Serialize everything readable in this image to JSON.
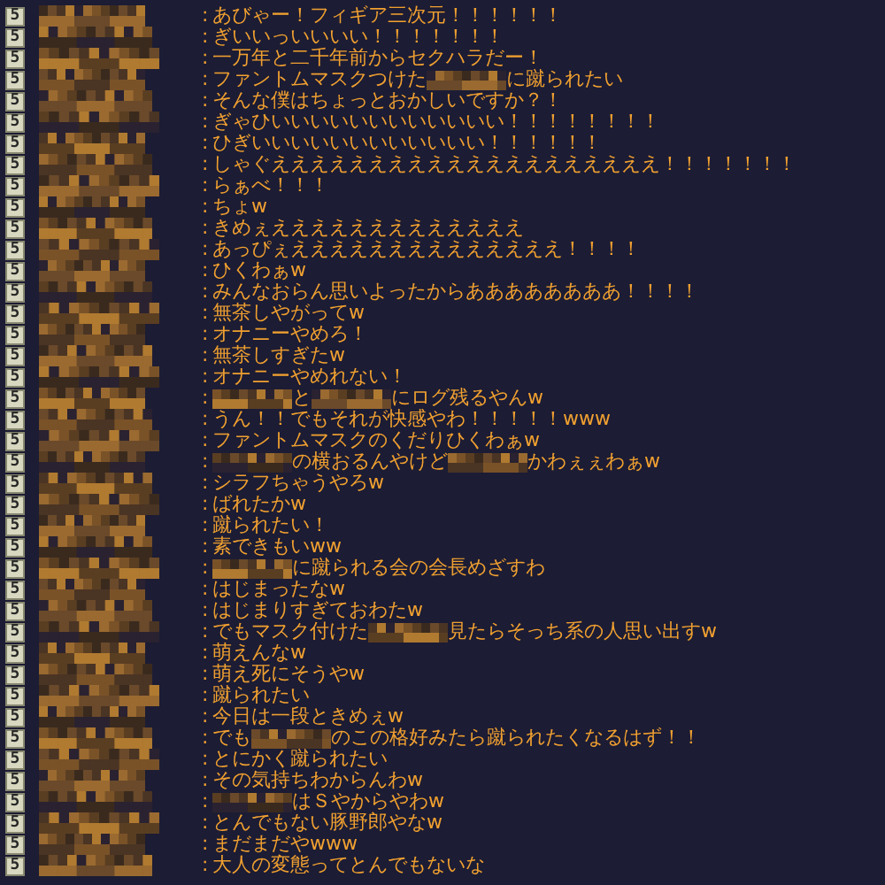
{
  "rows": [
    {
      "badge": "5",
      "sep": ":",
      "message": [
        {
          "kind": "text",
          "text": "あびゃー！フィギア三次元！！！！！！"
        }
      ]
    },
    {
      "badge": "5",
      "sep": ":",
      "message": [
        {
          "kind": "text",
          "text": "ぎいいっいいいい！！！！！！！"
        }
      ]
    },
    {
      "badge": "5",
      "sep": ":",
      "message": [
        {
          "kind": "text",
          "text": "一万年と二千年前からセクハラだー！"
        }
      ]
    },
    {
      "badge": "5",
      "sep": ":",
      "message": [
        {
          "kind": "text",
          "text": "ファントムマスクつけた"
        },
        {
          "kind": "mosaic"
        },
        {
          "kind": "text",
          "text": "に蹴られたい"
        }
      ]
    },
    {
      "badge": "5",
      "sep": ":",
      "message": [
        {
          "kind": "text",
          "text": "そんな僕はちょっとおかしいですか？！"
        }
      ]
    },
    {
      "badge": "5",
      "sep": ":",
      "message": [
        {
          "kind": "text",
          "text": "ぎゃひいいいいいいいいいいいい！！！！！！！！"
        }
      ]
    },
    {
      "badge": "5",
      "sep": ":",
      "message": [
        {
          "kind": "text",
          "text": "ひぎいいいいいいいいいいいい！！！！！！"
        }
      ]
    },
    {
      "badge": "5",
      "sep": ":",
      "message": [
        {
          "kind": "text",
          "text": "しゃぐええええええええええええええええええええ！！！！！！！"
        }
      ]
    },
    {
      "badge": "5",
      "sep": ":",
      "message": [
        {
          "kind": "text",
          "text": "らぁべ！！！"
        }
      ]
    },
    {
      "badge": "5",
      "sep": ":",
      "message": [
        {
          "kind": "text",
          "text": "ちょw"
        }
      ]
    },
    {
      "badge": "5",
      "sep": ":",
      "message": [
        {
          "kind": "text",
          "text": "きめぇえええええええええええええ"
        }
      ]
    },
    {
      "badge": "5",
      "sep": ":",
      "message": [
        {
          "kind": "text",
          "text": "あっぴぇええええええええええええええ！！！！"
        }
      ]
    },
    {
      "badge": "5",
      "sep": ":",
      "message": [
        {
          "kind": "text",
          "text": "ひくわぁw"
        }
      ]
    },
    {
      "badge": "5",
      "sep": ":",
      "message": [
        {
          "kind": "text",
          "text": "みんなおらん思いよったからああああああああ！！！！"
        }
      ]
    },
    {
      "badge": "5",
      "sep": ":",
      "message": [
        {
          "kind": "text",
          "text": "無茶しやがってw"
        }
      ]
    },
    {
      "badge": "5",
      "sep": ":",
      "message": [
        {
          "kind": "text",
          "text": "オナニーやめろ！"
        }
      ]
    },
    {
      "badge": "5",
      "sep": ":",
      "message": [
        {
          "kind": "text",
          "text": "無茶しすぎたw"
        }
      ]
    },
    {
      "badge": "5",
      "sep": ":",
      "message": [
        {
          "kind": "text",
          "text": "オナニーやめれない！"
        }
      ]
    },
    {
      "badge": "5",
      "sep": ":",
      "message": [
        {
          "kind": "mosaic"
        },
        {
          "kind": "text",
          "text": "と"
        },
        {
          "kind": "mosaic"
        },
        {
          "kind": "text",
          "text": "にログ残るやんw"
        }
      ]
    },
    {
      "badge": "5",
      "sep": ":",
      "message": [
        {
          "kind": "text",
          "text": "うん！！でもそれが快感やわ！！！！！www"
        }
      ]
    },
    {
      "badge": "5",
      "sep": ":",
      "message": [
        {
          "kind": "text",
          "text": "ファントムマスクのくだりひくわぁw"
        }
      ]
    },
    {
      "badge": "5",
      "sep": ":",
      "message": [
        {
          "kind": "mosaic"
        },
        {
          "kind": "text",
          "text": "の横おるんやけど"
        },
        {
          "kind": "mosaic"
        },
        {
          "kind": "text",
          "text": "かわぇぇわぁw"
        }
      ]
    },
    {
      "badge": "5",
      "sep": ":",
      "message": [
        {
          "kind": "text",
          "text": "シラフちゃうやろw"
        }
      ]
    },
    {
      "badge": "5",
      "sep": ":",
      "message": [
        {
          "kind": "text",
          "text": "ばれたかw"
        }
      ]
    },
    {
      "badge": "5",
      "sep": ":",
      "message": [
        {
          "kind": "text",
          "text": "蹴られたい！"
        }
      ]
    },
    {
      "badge": "5",
      "sep": ":",
      "message": [
        {
          "kind": "text",
          "text": "素できもいww"
        }
      ]
    },
    {
      "badge": "5",
      "sep": ":",
      "message": [
        {
          "kind": "mosaic"
        },
        {
          "kind": "text",
          "text": "に蹴られる会の会長めざすわ"
        }
      ]
    },
    {
      "badge": "5",
      "sep": ":",
      "message": [
        {
          "kind": "text",
          "text": "はじまったなw"
        }
      ]
    },
    {
      "badge": "5",
      "sep": ":",
      "message": [
        {
          "kind": "text",
          "text": "はじまりすぎておわたw"
        }
      ]
    },
    {
      "badge": "5",
      "sep": ":",
      "message": [
        {
          "kind": "text",
          "text": "でもマスク付けた"
        },
        {
          "kind": "mosaic"
        },
        {
          "kind": "text",
          "text": "見たらそっち系の人思い出すw"
        }
      ]
    },
    {
      "badge": "5",
      "sep": ":",
      "message": [
        {
          "kind": "text",
          "text": "萌えんなw"
        }
      ]
    },
    {
      "badge": "5",
      "sep": ":",
      "message": [
        {
          "kind": "text",
          "text": "萌え死にそうやw"
        }
      ]
    },
    {
      "badge": "5",
      "sep": ":",
      "message": [
        {
          "kind": "text",
          "text": "蹴られたい"
        }
      ]
    },
    {
      "badge": "5",
      "sep": ":",
      "message": [
        {
          "kind": "text",
          "text": "今日は一段ときめぇw"
        }
      ]
    },
    {
      "badge": "5",
      "sep": ":",
      "message": [
        {
          "kind": "text",
          "text": "でも"
        },
        {
          "kind": "mosaic"
        },
        {
          "kind": "text",
          "text": "のこの格好みたら蹴られたくなるはず！！"
        }
      ]
    },
    {
      "badge": "5",
      "sep": ":",
      "message": [
        {
          "kind": "text",
          "text": "とにかく蹴られたい"
        }
      ]
    },
    {
      "badge": "5",
      "sep": ":",
      "message": [
        {
          "kind": "text",
          "text": "その気持ちわからんわw"
        }
      ]
    },
    {
      "badge": "5",
      "sep": ":",
      "message": [
        {
          "kind": "mosaic"
        },
        {
          "kind": "text",
          "text": "はＳやからやわw"
        }
      ]
    },
    {
      "badge": "5",
      "sep": ":",
      "message": [
        {
          "kind": "text",
          "text": "とんでもない豚野郎やなw"
        }
      ]
    },
    {
      "badge": "5",
      "sep": ":",
      "message": [
        {
          "kind": "text",
          "text": "まだまだやwww"
        }
      ]
    },
    {
      "badge": "5",
      "sep": ":",
      "message": [
        {
          "kind": "text",
          "text": "大人の変態ってとんでもないな"
        }
      ]
    }
  ]
}
